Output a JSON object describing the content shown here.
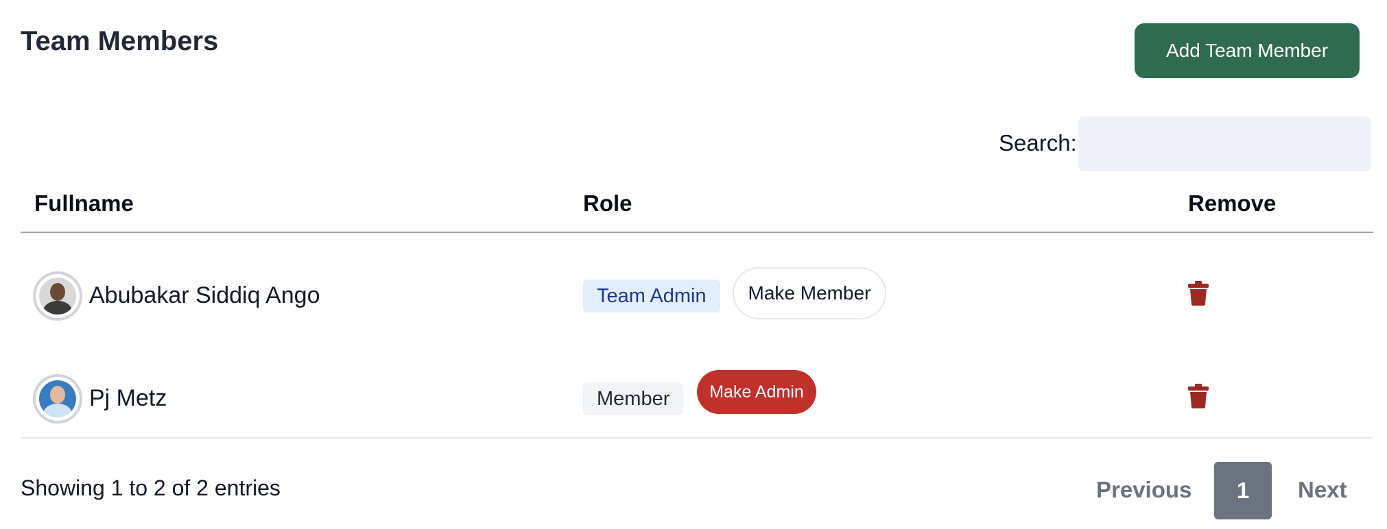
{
  "header": {
    "title": "Team Members",
    "add_button_label": "Add Team Member",
    "accent_color": "#2e6b4f"
  },
  "search": {
    "label": "Search:",
    "value": "",
    "placeholder": ""
  },
  "table": {
    "columns": {
      "fullname": "Fullname",
      "role": "Role",
      "remove": "Remove"
    },
    "rows": [
      {
        "name": "Abubakar Siddiq Ango",
        "role": "Team Admin",
        "action_label": "Make Member",
        "avatar_icon": "user-avatar-icon",
        "remove_icon": "trash-icon"
      },
      {
        "name": "Pj Metz",
        "role": "Member",
        "action_label": "Make Admin",
        "avatar_icon": "user-avatar-icon",
        "remove_icon": "trash-icon"
      }
    ]
  },
  "footer": {
    "info": "Showing 1 to 2 of 2 entries"
  },
  "pagination": {
    "previous_label": "Previous",
    "current_page": "1",
    "next_label": "Next"
  },
  "colors": {
    "danger": "#c0312b",
    "trash": "#9b2a25",
    "admin_badge_bg": "#e2eefb",
    "admin_badge_text": "#1e3a8a"
  }
}
